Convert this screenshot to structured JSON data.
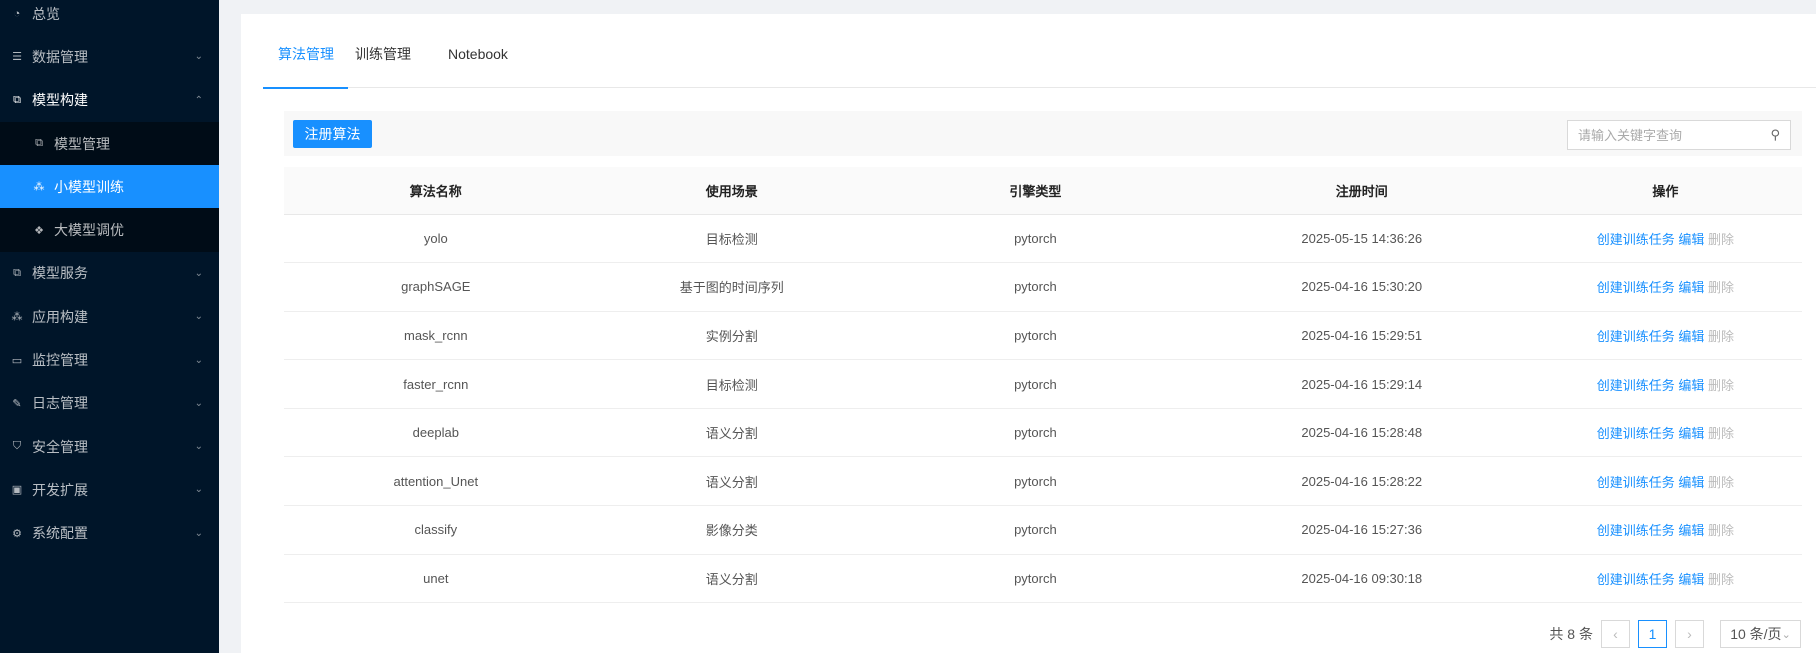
{
  "sidebar": {
    "items": [
      {
        "label": "总览",
        "icon": "dashboard-icon"
      },
      {
        "label": "数据管理",
        "icon": "database-icon"
      },
      {
        "label": "模型构建",
        "icon": "model-build-icon",
        "sub": [
          {
            "label": "模型管理"
          },
          {
            "label": "小模型训练"
          },
          {
            "label": "大模型调优"
          }
        ]
      },
      {
        "label": "模型服务"
      },
      {
        "label": "应用构建"
      },
      {
        "label": "监控管理"
      },
      {
        "label": "日志管理"
      },
      {
        "label": "安全管理"
      },
      {
        "label": "开发扩展"
      },
      {
        "label": "系统配置"
      }
    ]
  },
  "tabs": [
    "算法管理",
    "训练管理",
    "Notebook"
  ],
  "toolbar": {
    "register_label": "注册算法",
    "search_placeholder": "请输入关键字查询"
  },
  "table": {
    "headers": [
      "算法名称",
      "使用场景",
      "引擎类型",
      "注册时间",
      "操作"
    ],
    "rows": [
      [
        "yolo",
        "目标检测",
        "pytorch",
        "2025-05-15 14:36:26"
      ],
      [
        "graphSAGE",
        "基于图的时间序列",
        "pytorch",
        "2025-04-16 15:30:20"
      ],
      [
        "mask_rcnn",
        "实例分割",
        "pytorch",
        "2025-04-16 15:29:51"
      ],
      [
        "faster_rcnn",
        "目标检测",
        "pytorch",
        "2025-04-16 15:29:14"
      ],
      [
        "deeplab",
        "语义分割",
        "pytorch",
        "2025-04-16 15:28:48"
      ],
      [
        "attention_Unet",
        "语义分割",
        "pytorch",
        "2025-04-16 15:28:22"
      ],
      [
        "classify",
        "影像分类",
        "pytorch",
        "2025-04-16 15:27:36"
      ],
      [
        "unet",
        "语义分割",
        "pytorch",
        "2025-04-16 09:30:18"
      ]
    ],
    "actions": {
      "create": "创建训练任务",
      "edit": "编辑",
      "delete": "删除"
    }
  },
  "pagination": {
    "total": "共 8 条",
    "page": "1",
    "page_size": "10 条/页"
  }
}
